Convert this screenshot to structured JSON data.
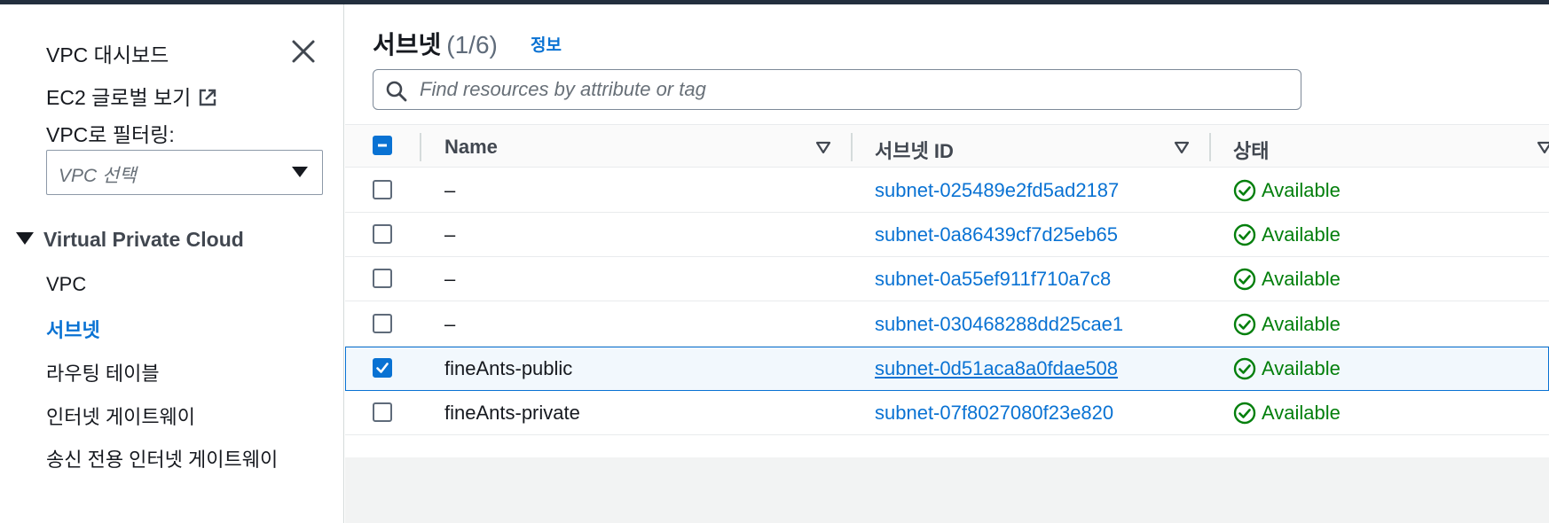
{
  "sidebar": {
    "title": "VPC 대시보드",
    "ec2_global_view": "EC2 글로벌 보기",
    "filter_label": "VPC로 필터링:",
    "vpc_select_placeholder": "VPC 선택",
    "section_title": "Virtual Private Cloud",
    "items": [
      {
        "label": "VPC",
        "active": false
      },
      {
        "label": "서브넷",
        "active": true
      },
      {
        "label": "라우팅 테이블",
        "active": false
      },
      {
        "label": "인터넷 게이트웨이",
        "active": false
      },
      {
        "label": "송신 전용 인터넷 게이트웨이",
        "active": false
      }
    ]
  },
  "main": {
    "heading": "서브넷",
    "count": "(1/6)",
    "info_link": "정보",
    "search_placeholder": "Find resources by attribute or tag",
    "columns": [
      "Name",
      "서브넷 ID",
      "상태"
    ],
    "rows": [
      {
        "name": "–",
        "subnet_id": "subnet-025489e2fd5ad2187",
        "status": "Available",
        "selected": false
      },
      {
        "name": "–",
        "subnet_id": "subnet-0a86439cf7d25eb65",
        "status": "Available",
        "selected": false
      },
      {
        "name": "–",
        "subnet_id": "subnet-0a55ef911f710a7c8",
        "status": "Available",
        "selected": false
      },
      {
        "name": "–",
        "subnet_id": "subnet-030468288dd25cae1",
        "status": "Available",
        "selected": false
      },
      {
        "name": "fineAnts-public",
        "subnet_id": "subnet-0d51aca8a0fdae508",
        "status": "Available",
        "selected": true
      },
      {
        "name": "fineAnts-private",
        "subnet_id": "subnet-07f8027080f23e820",
        "status": "Available",
        "selected": false
      }
    ]
  },
  "colors": {
    "link": "#0972d3",
    "status_ok": "#037f0c",
    "topbar": "#232f3e"
  },
  "icons": {
    "close": "close-icon",
    "external": "external-link-icon",
    "search": "search-icon",
    "status": "status-available-icon",
    "sort": "sort-caret-icon"
  }
}
